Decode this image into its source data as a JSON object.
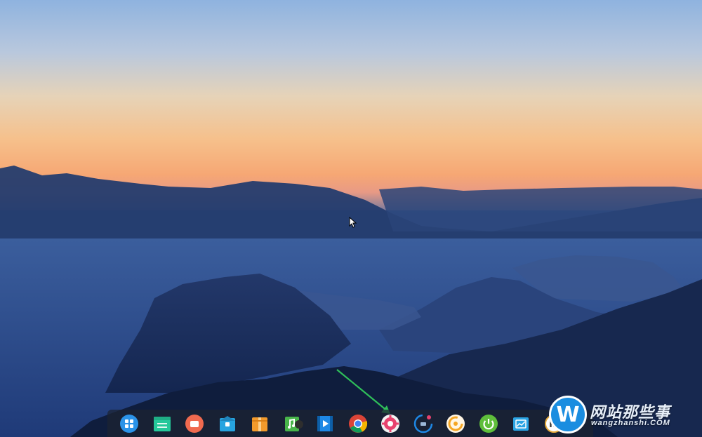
{
  "desktop": {
    "wallpaper": "mountain sunset landscape"
  },
  "dock": {
    "items": [
      {
        "icon": "launcher-icon",
        "color": "#2b93e8"
      },
      {
        "icon": "file-manager-icon",
        "color": "#25c89a"
      },
      {
        "icon": "screen-recorder-icon",
        "color": "#f06a4f"
      },
      {
        "icon": "app-store-icon",
        "color": "#27a4e0"
      },
      {
        "icon": "archive-manager-icon",
        "color": "#f29a2c"
      },
      {
        "icon": "music-icon",
        "color": "#48b54a"
      },
      {
        "icon": "video-player-icon",
        "color": "#1e88e5"
      },
      {
        "icon": "chrome-icon",
        "color": "#4285f4"
      },
      {
        "icon": "control-center-icon",
        "color": "#e8426e"
      },
      {
        "icon": "system-monitor-icon",
        "color": "#1e88e5"
      },
      {
        "icon": "sunshine-icon",
        "color": "#f5a623"
      },
      {
        "icon": "shutdown-icon",
        "color": "#5fbe3b"
      },
      {
        "icon": "screenshot-icon",
        "color": "#2aa4e4"
      },
      {
        "icon": "deepin-editor-icon",
        "color": "#e5a93a"
      }
    ]
  },
  "watermark": {
    "badge": "W",
    "title": "网站那些事",
    "url": "wangzhanshi.COM"
  }
}
